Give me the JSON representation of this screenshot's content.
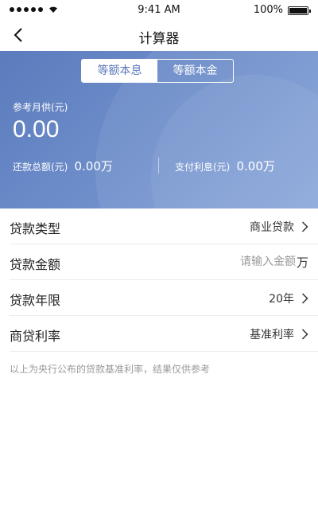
{
  "status_bar": {
    "time": "9:41 AM",
    "battery": "100%"
  },
  "nav": {
    "title": "计算器"
  },
  "tabs": [
    {
      "label": "等额本息",
      "active": true
    },
    {
      "label": "等额本金",
      "active": false
    }
  ],
  "summary": {
    "monthly_label": "参考月供(元)",
    "monthly_value": "0.00",
    "total_label": "还款总额(元)",
    "total_value": "0.00万",
    "interest_label": "支付利息(元)",
    "interest_value": "0.00万"
  },
  "form": {
    "loan_type": {
      "label": "贷款类型",
      "value": "商业贷款"
    },
    "amount": {
      "label": "贷款金额",
      "placeholder": "请输入金额",
      "unit": "万"
    },
    "term": {
      "label": "贷款年限",
      "value": "20年"
    },
    "rate": {
      "label": "商贷利率",
      "value": "基准利率"
    }
  },
  "note": "以上为央行公布的贷款基准利率，结果仅供参考",
  "colors": {
    "hero_start": "#5c7bbd",
    "hero_end": "#86a3d9",
    "accent": "#5b79bb"
  }
}
